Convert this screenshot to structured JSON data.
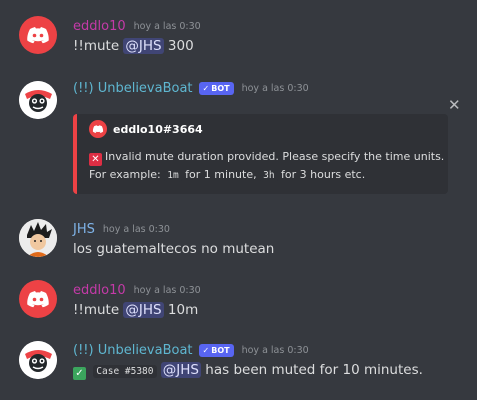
{
  "messages": [
    {
      "username": "eddlo10",
      "timestamp": "hoy a las 0:30",
      "pre": "!!mute ",
      "mention": "@JHS",
      "post": " 300"
    },
    {
      "username": "(!!) UnbelievaBoat",
      "bot_label": "BOT",
      "timestamp": "hoy a las 0:30",
      "embed": {
        "author": "eddlo10#3664",
        "line1": "Invalid mute duration provided. Please specify the time units.",
        "line2_a": "For example: ",
        "code1": "1m",
        "line2_b": " for 1 minute, ",
        "code2": "3h",
        "line2_c": " for 3 hours etc."
      }
    },
    {
      "username": "JHS",
      "timestamp": "hoy a las 0:30",
      "text": "los guatemaltecos no mutean"
    },
    {
      "username": "eddlo10",
      "timestamp": "hoy a las 0:30",
      "pre": "!!mute ",
      "mention": "@JHS",
      "post": " 10m"
    },
    {
      "username": "(!!) UnbelievaBoat",
      "bot_label": "BOT",
      "timestamp": "hoy a las 0:30",
      "code": "Case #5380",
      "mention": "@JHS",
      "post": " has been muted for 10 minutes."
    }
  ],
  "colors": {
    "background": "#36393f",
    "embed_border": "#ed4245",
    "eddlo10": "#c43aa8",
    "bot": "#5fb7d1",
    "jhs": "#7fb3e8",
    "mention_bg": "#5865f2"
  },
  "icons": {
    "discord_avatar": "discord-logo-icon",
    "bot_avatar": "unbelievaboat-icon",
    "error": "cross-mark-icon",
    "success": "check-mark-icon",
    "close": "close-icon"
  }
}
